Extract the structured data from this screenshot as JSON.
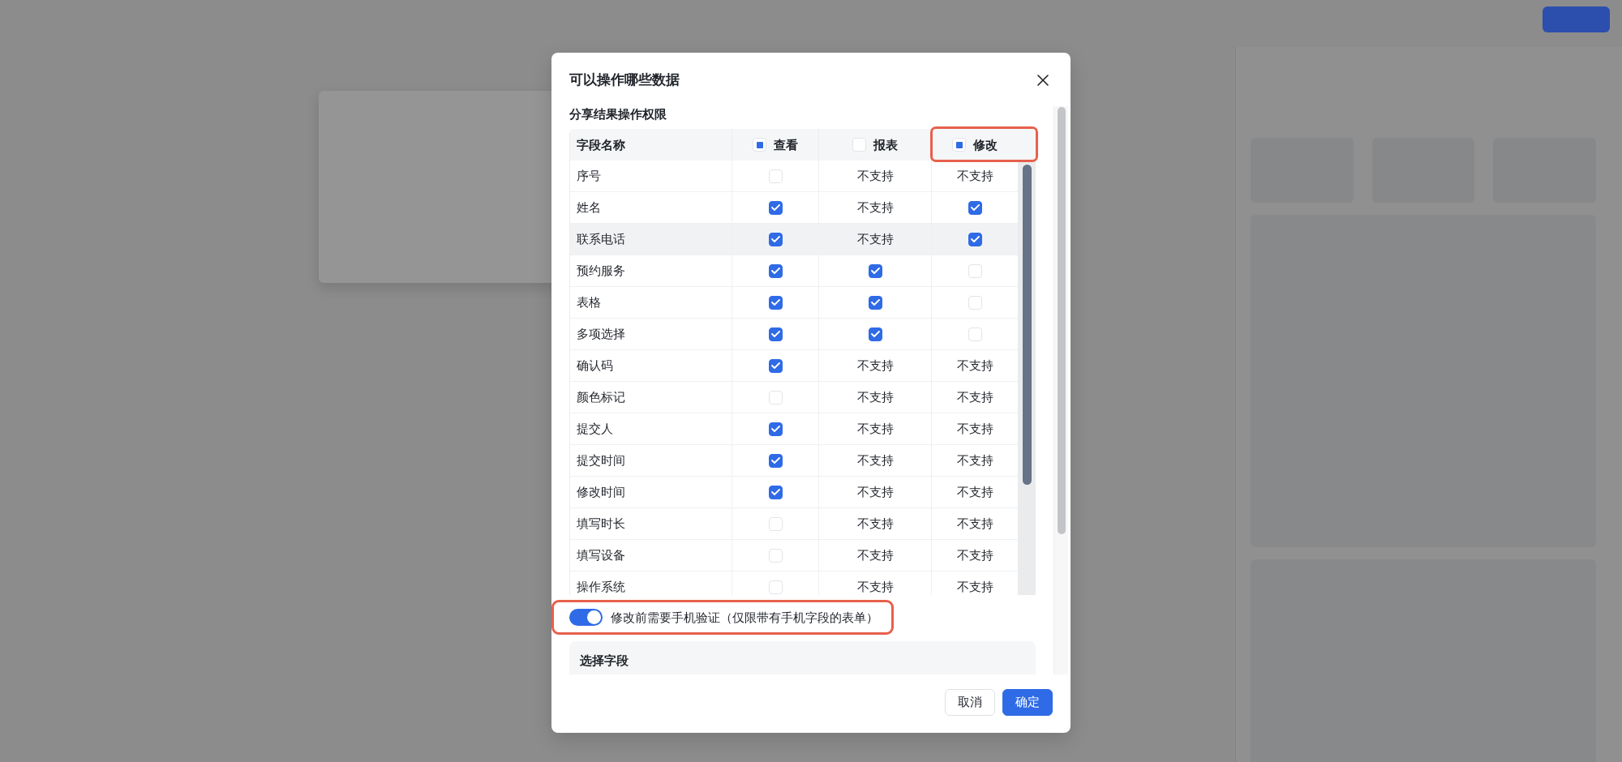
{
  "dialog": {
    "title": "可以操作哪些数据",
    "section_title": "分享结果操作权限",
    "table": {
      "columns": [
        {
          "label": "字段名称",
          "kind": "name",
          "highlighted": false
        },
        {
          "label": "查看",
          "kind": "checkbox",
          "indeterminate": true,
          "highlighted": false
        },
        {
          "label": "报表",
          "kind": "checkbox",
          "indeterminate": false,
          "highlighted": false
        },
        {
          "label": "修改",
          "kind": "checkbox",
          "indeterminate": true,
          "highlighted": true
        }
      ],
      "rows": [
        {
          "hovered": false,
          "cells": [
            {
              "kind": "name",
              "text": "序号"
            },
            {
              "kind": "checkbox",
              "checked": false
            },
            {
              "kind": "text",
              "text": "不支持"
            },
            {
              "kind": "text",
              "text": "不支持"
            }
          ]
        },
        {
          "hovered": false,
          "cells": [
            {
              "kind": "name",
              "text": "姓名"
            },
            {
              "kind": "checkbox",
              "checked": true
            },
            {
              "kind": "text",
              "text": "不支持"
            },
            {
              "kind": "checkbox",
              "checked": true
            }
          ]
        },
        {
          "hovered": true,
          "cells": [
            {
              "kind": "name",
              "text": "联系电话"
            },
            {
              "kind": "checkbox",
              "checked": true
            },
            {
              "kind": "text",
              "text": "不支持"
            },
            {
              "kind": "checkbox",
              "checked": true
            }
          ]
        },
        {
          "hovered": false,
          "cells": [
            {
              "kind": "name",
              "text": "预约服务"
            },
            {
              "kind": "checkbox",
              "checked": true
            },
            {
              "kind": "checkbox",
              "checked": true
            },
            {
              "kind": "checkbox",
              "checked": false
            }
          ]
        },
        {
          "hovered": false,
          "cells": [
            {
              "kind": "name",
              "text": "表格"
            },
            {
              "kind": "checkbox",
              "checked": true
            },
            {
              "kind": "checkbox",
              "checked": true
            },
            {
              "kind": "checkbox",
              "checked": false
            }
          ]
        },
        {
          "hovered": false,
          "cells": [
            {
              "kind": "name",
              "text": "多项选择"
            },
            {
              "kind": "checkbox",
              "checked": true
            },
            {
              "kind": "checkbox",
              "checked": true
            },
            {
              "kind": "checkbox",
              "checked": false
            }
          ]
        },
        {
          "hovered": false,
          "cells": [
            {
              "kind": "name",
              "text": "确认码"
            },
            {
              "kind": "checkbox",
              "checked": true
            },
            {
              "kind": "text",
              "text": "不支持"
            },
            {
              "kind": "text",
              "text": "不支持"
            }
          ]
        },
        {
          "hovered": false,
          "cells": [
            {
              "kind": "name",
              "text": "颜色标记"
            },
            {
              "kind": "checkbox",
              "checked": false
            },
            {
              "kind": "text",
              "text": "不支持"
            },
            {
              "kind": "text",
              "text": "不支持"
            }
          ]
        },
        {
          "hovered": false,
          "cells": [
            {
              "kind": "name",
              "text": "提交人"
            },
            {
              "kind": "checkbox",
              "checked": true
            },
            {
              "kind": "text",
              "text": "不支持"
            },
            {
              "kind": "text",
              "text": "不支持"
            }
          ]
        },
        {
          "hovered": false,
          "cells": [
            {
              "kind": "name",
              "text": "提交时间"
            },
            {
              "kind": "checkbox",
              "checked": true
            },
            {
              "kind": "text",
              "text": "不支持"
            },
            {
              "kind": "text",
              "text": "不支持"
            }
          ]
        },
        {
          "hovered": false,
          "cells": [
            {
              "kind": "name",
              "text": "修改时间"
            },
            {
              "kind": "checkbox",
              "checked": true
            },
            {
              "kind": "text",
              "text": "不支持"
            },
            {
              "kind": "text",
              "text": "不支持"
            }
          ]
        },
        {
          "hovered": false,
          "cells": [
            {
              "kind": "name",
              "text": "填写时长"
            },
            {
              "kind": "checkbox",
              "checked": false
            },
            {
              "kind": "text",
              "text": "不支持"
            },
            {
              "kind": "text",
              "text": "不支持"
            }
          ]
        },
        {
          "hovered": false,
          "cells": [
            {
              "kind": "name",
              "text": "填写设备"
            },
            {
              "kind": "checkbox",
              "checked": false
            },
            {
              "kind": "text",
              "text": "不支持"
            },
            {
              "kind": "text",
              "text": "不支持"
            }
          ]
        },
        {
          "hovered": false,
          "cells": [
            {
              "kind": "name",
              "text": "操作系统"
            },
            {
              "kind": "checkbox",
              "checked": false
            },
            {
              "kind": "text",
              "text": "不支持"
            },
            {
              "kind": "text",
              "text": "不支持"
            }
          ]
        }
      ]
    },
    "verification_toggle": {
      "label": "修改前需要手机验证（仅限带有手机字段的表单）",
      "on": true,
      "highlighted": true
    },
    "field_section": {
      "title": "选择字段"
    },
    "buttons": [
      {
        "label": "取消",
        "kind": "secondary"
      },
      {
        "label": "确定",
        "kind": "primary"
      }
    ]
  }
}
